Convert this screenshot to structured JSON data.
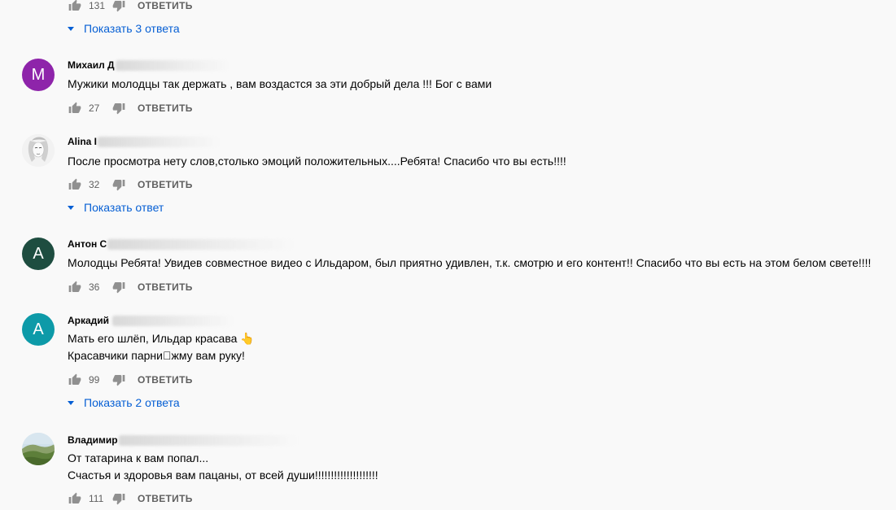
{
  "reply_label": "ОТВЕТИТЬ",
  "top": {
    "likes": "131",
    "show_replies": "Показать 3 ответа"
  },
  "comments": [
    {
      "author": "Михаил Д",
      "avatar_letter": "M",
      "avatar_color": "#8e24aa",
      "text_lines": [
        "Мужики молодцы так держать , вам воздастся за эти добрый дела !!! Бог с вами"
      ],
      "likes": "27"
    },
    {
      "author": "Alina I",
      "avatar_letter": "",
      "avatar_color": "#eeeeee",
      "text_lines": [
        "После просмотра нету слов,столько эмоций положительных....Ребята! Спасибо что вы есть!!!!"
      ],
      "likes": "32",
      "show_replies": "Показать ответ"
    },
    {
      "author": "Антон С",
      "avatar_letter": "A",
      "avatar_color": "#1e4d40",
      "text_lines": [
        "Молодцы Ребята! Увидев совместное видео с Ильдаром, был приятно удивлен, т.к. смотрю и его контент!! Спасибо что вы есть на этом белом свете!!!!"
      ],
      "likes": "36"
    },
    {
      "author": "Аркадий",
      "avatar_letter": "A",
      "avatar_color": "#0d9aa8",
      "text_lines": [
        "Мать его шлёп, Ильдар красава 👆",
        "Красавчики парни􀀀жму вам руку!"
      ],
      "likes": "99",
      "show_replies": "Показать 2 ответа"
    },
    {
      "author": "Владимир",
      "avatar_letter": "",
      "avatar_color": "#6b8f4e",
      "text_lines": [
        "От татарина к вам попал...",
        "Счастья и здоровья вам пацаны, от всей души!!!!!!!!!!!!!!!!!!!!"
      ],
      "likes": "111"
    }
  ]
}
